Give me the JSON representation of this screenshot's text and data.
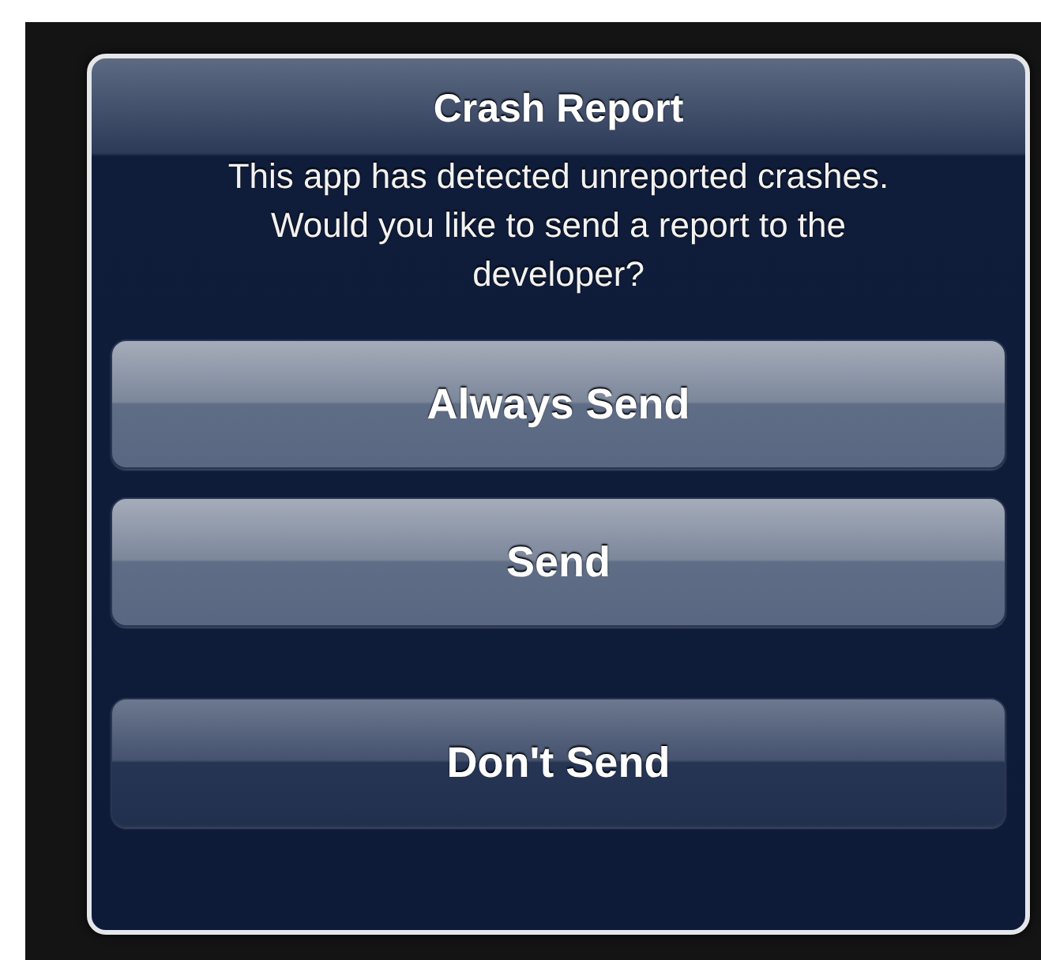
{
  "alert": {
    "title": "Crash Report",
    "message": "This app has detected unreported crashes. Would you like to send a report to the developer?",
    "buttons": [
      {
        "label": "Always Send",
        "kind": "action"
      },
      {
        "label": "Send",
        "kind": "action"
      },
      {
        "label": "Don't Send",
        "kind": "cancel"
      }
    ]
  }
}
